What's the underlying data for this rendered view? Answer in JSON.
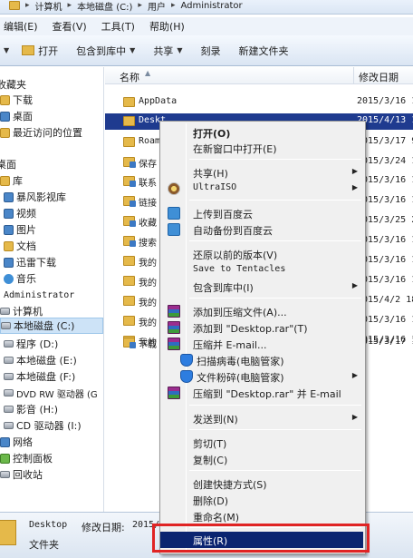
{
  "address": {
    "segments": [
      "计算机",
      "本地磁盘 (C:)",
      "用户",
      "Administrator"
    ]
  },
  "menubar": [
    "编辑(E)",
    "查看(V)",
    "工具(T)",
    "帮助(H)"
  ],
  "toolbar": {
    "open": "打开",
    "include_library": "包含到库中",
    "share": "共享",
    "burn": "刻录",
    "new_folder": "新建文件夹"
  },
  "nav": {
    "items": [
      {
        "label": "收藏夹"
      },
      {
        "label": "下载"
      },
      {
        "label": "桌面"
      },
      {
        "label": "最近访问的位置"
      },
      {
        "label": "桌面"
      },
      {
        "label": "库"
      },
      {
        "label": "暴风影视库"
      },
      {
        "label": "视频"
      },
      {
        "label": "图片"
      },
      {
        "label": "文档"
      },
      {
        "label": "迅雷下载"
      },
      {
        "label": "音乐"
      },
      {
        "label": "Administrator"
      },
      {
        "label": "计算机"
      },
      {
        "label": "本地磁盘 (C:)"
      },
      {
        "label": "程序 (D:)"
      },
      {
        "label": "本地磁盘 (E:)"
      },
      {
        "label": "本地磁盘 (F:)"
      },
      {
        "label": "DVD RW 驱动器 (G"
      },
      {
        "label": "影音 (H:)"
      },
      {
        "label": "CD 驱动器 (I:)"
      },
      {
        "label": "网络"
      },
      {
        "label": "控制面板"
      },
      {
        "label": "回收站"
      }
    ]
  },
  "columns": {
    "name": "名称",
    "date": "修改日期"
  },
  "files": [
    {
      "name": "AppData",
      "date": "2015/3/16 1"
    },
    {
      "name": "Deskt",
      "date": "2015/4/13 1"
    },
    {
      "name": "Roam",
      "date": "2015/3/17 9"
    },
    {
      "name": "保存",
      "date": "2015/3/24 1"
    },
    {
      "name": "联系",
      "date": "2015/3/16 1"
    },
    {
      "name": "链接",
      "date": "2015/3/16 1"
    },
    {
      "name": "收藏",
      "date": "2015/3/25 2"
    },
    {
      "name": "搜索",
      "date": "2015/3/16 1"
    },
    {
      "name": "我的",
      "date": "2015/3/16 1"
    },
    {
      "name": "我的",
      "date": "2015/3/16 1"
    },
    {
      "name": "我的",
      "date": "2015/4/2 18"
    },
    {
      "name": "我的",
      "date": "2015/3/16 1"
    },
    {
      "name": "我的",
      "date": "2015/3/16 1"
    },
    {
      "name": "下载",
      "date": "2015/3/17 1"
    }
  ],
  "details": {
    "name": "Desktop",
    "modified_label": "修改日期:",
    "modified_value": "2015/",
    "type": "文件夹"
  },
  "context_menu": {
    "open": "打开(O)",
    "open_new_window": "在新窗口中打开(E)",
    "share": "共享(H)",
    "ultraiso": "UltraISO",
    "upload_baidu": "上传到百度云",
    "auto_backup_baidu": "自动备份到百度云",
    "restore_prev": "还原以前的版本(V)",
    "save_tentacles": "Save to Tentacles",
    "include_library": "包含到库中(I)",
    "add_archive": "添加到压缩文件(A)...",
    "add_desktop_rar": "添加到 \"Desktop.rar\"(T)",
    "compress_email": "压缩并 E-mail...",
    "scan_virus": "扫描病毒(电脑管家)",
    "shred": "文件粉碎(电脑管家)",
    "compress_rar_email": "压缩到 \"Desktop.rar\" 并 E-mail",
    "send_to": "发送到(N)",
    "cut": "剪切(T)",
    "copy": "复制(C)",
    "create_shortcut": "创建快捷方式(S)",
    "delete": "删除(D)",
    "rename": "重命名(M)",
    "properties": "属性(R)"
  },
  "colors": {
    "selection": "#1f3b8f",
    "menu_highlight": "#0a2470",
    "annotation": "#e02424"
  }
}
